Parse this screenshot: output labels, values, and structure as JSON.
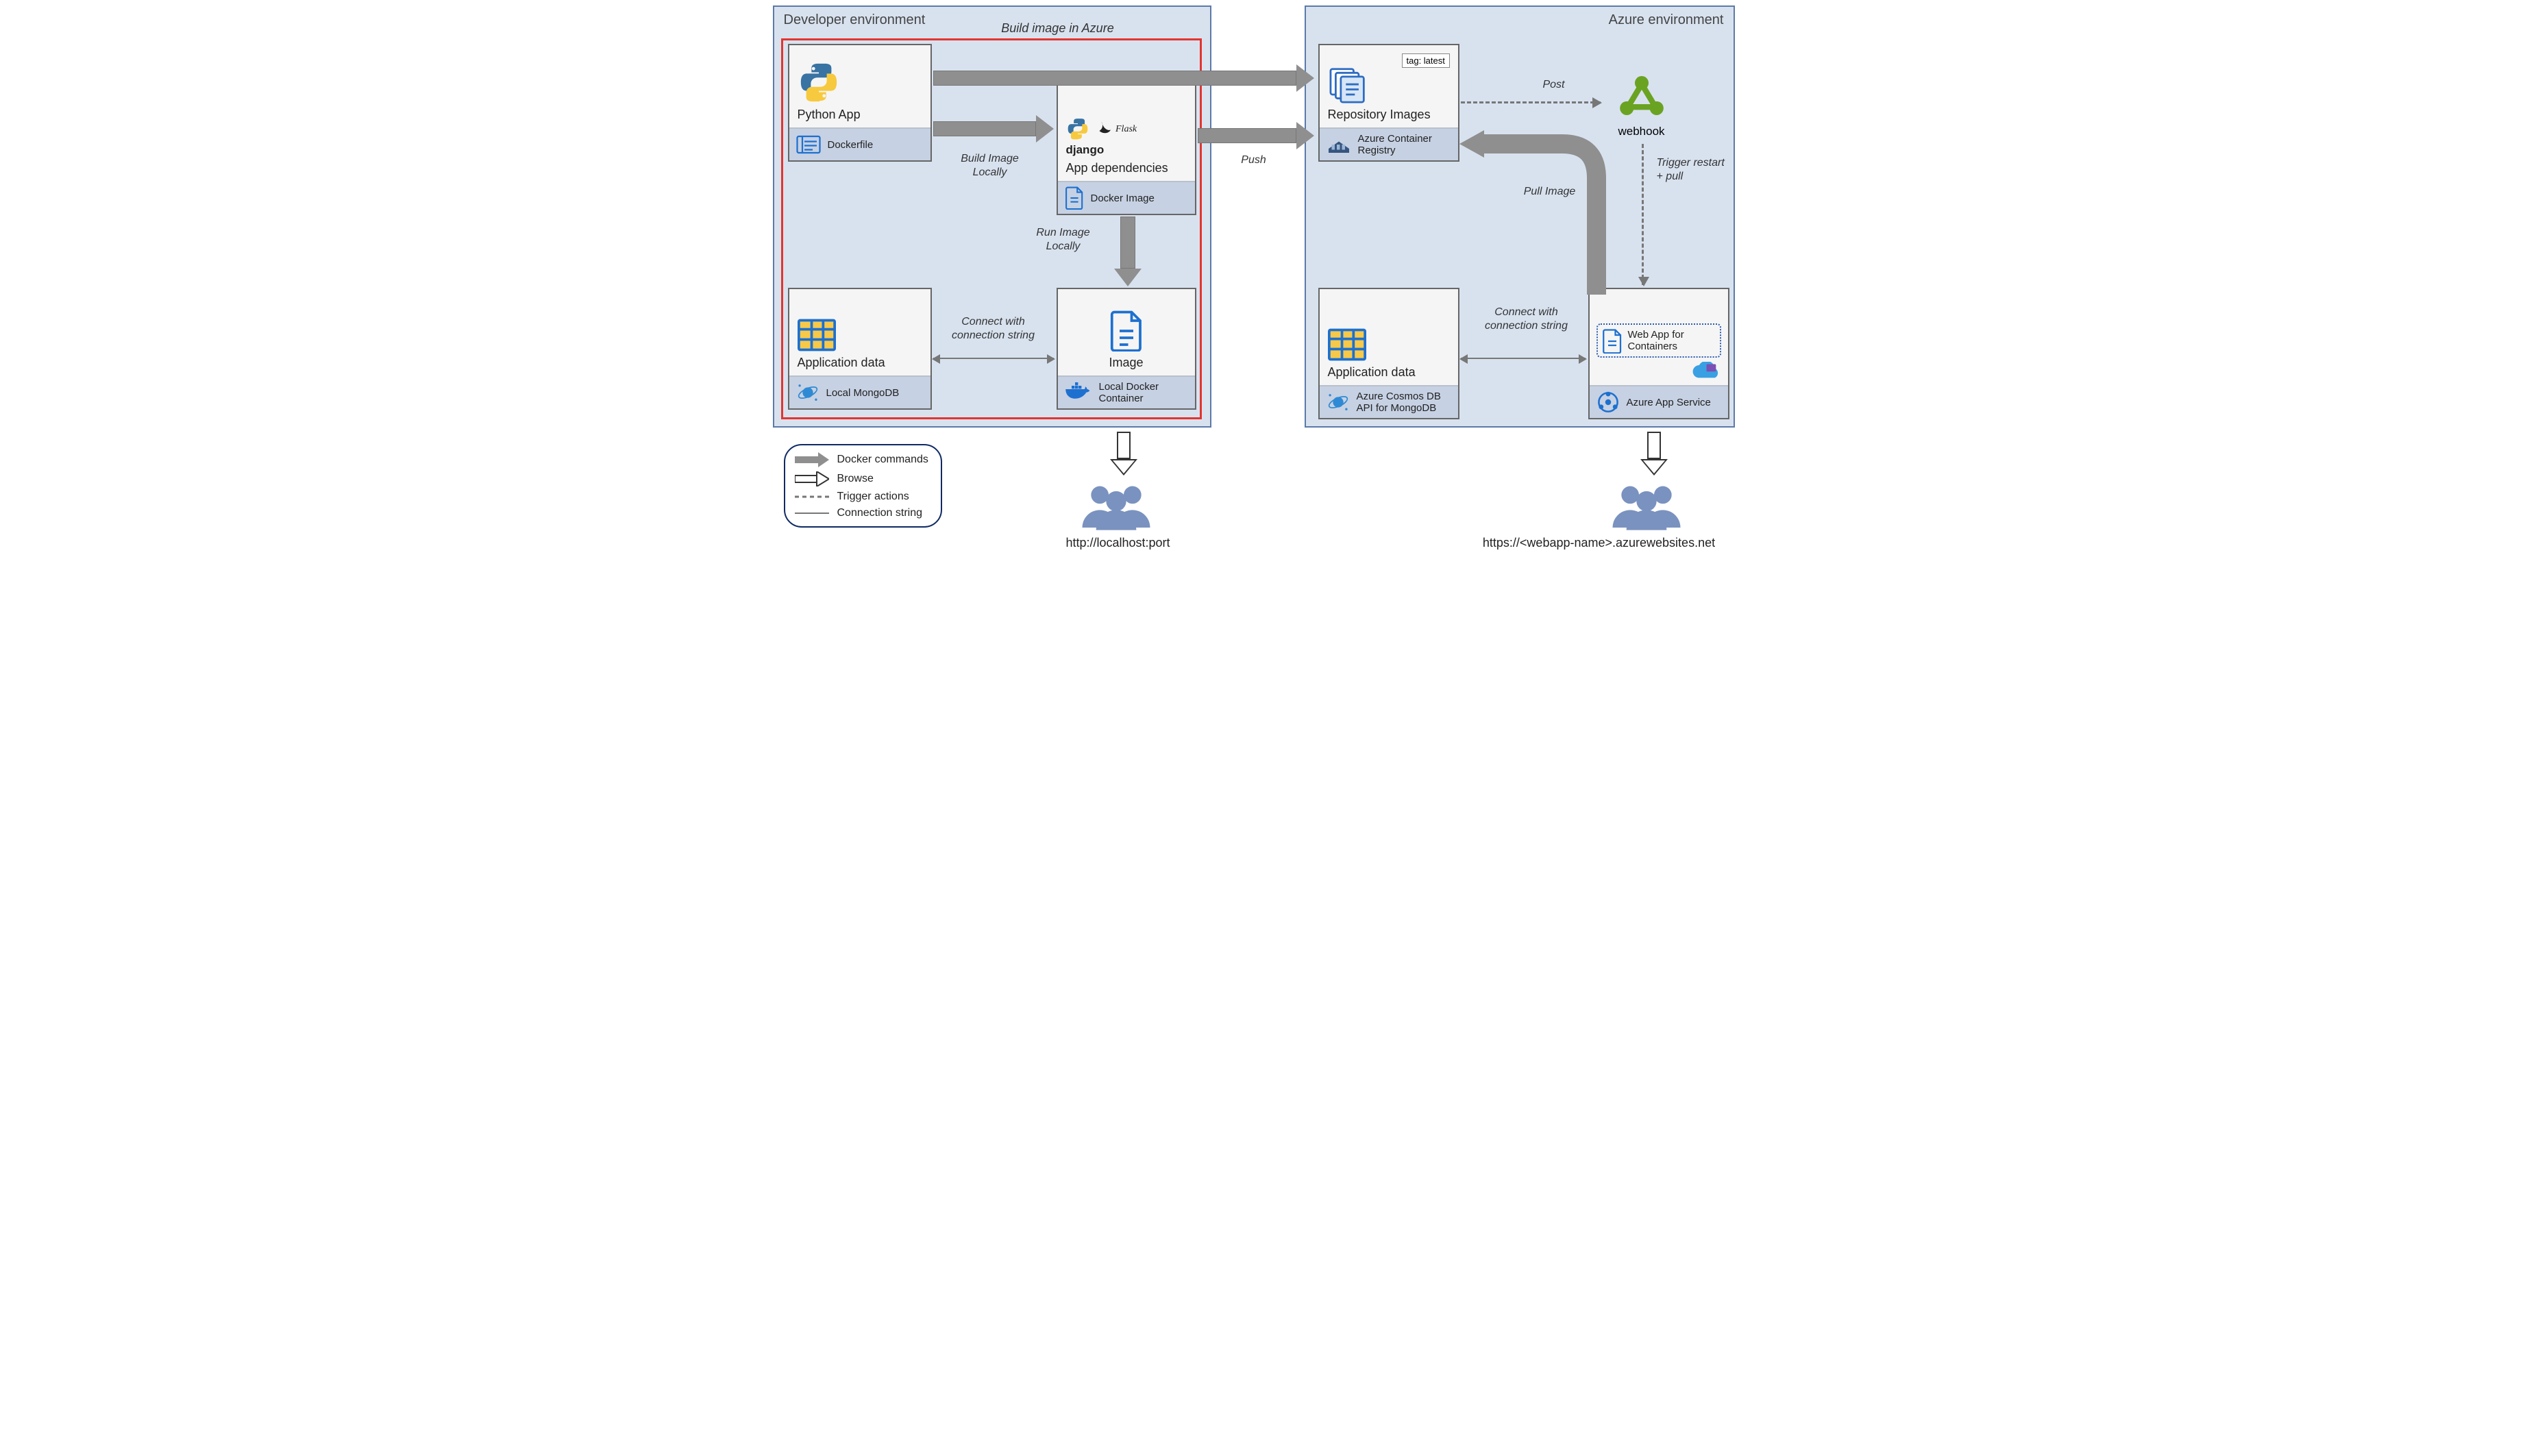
{
  "dev_env": {
    "title": "Developer environment"
  },
  "azure_env": {
    "title": "Azure environment"
  },
  "cards": {
    "python_app": {
      "title": "Python App",
      "footer": "Dockerfile"
    },
    "app_deps": {
      "title": "App dependencies",
      "footer": "Docker Image",
      "flask": "Flask",
      "django": "django"
    },
    "app_data_local": {
      "title": "Application data",
      "footer": "Local MongoDB"
    },
    "image_local": {
      "title": "Image",
      "footer": "Local Docker Container"
    },
    "repo_images": {
      "title": "Repository Images",
      "footer": "Azure Container Registry",
      "tag": "tag: latest"
    },
    "webhook": {
      "title": "webhook"
    },
    "app_data_azure": {
      "title": "Application data",
      "footer": "Azure Cosmos DB API for MongoDB"
    },
    "web_app": {
      "inner": "Web App for Containers",
      "footer": "Azure App Service"
    }
  },
  "arrows": {
    "build_azure": "Build image in Azure",
    "build_locally": "Build Image Locally",
    "run_locally": "Run Image Locally",
    "push": "Push",
    "connect_local": "Connect with connection string",
    "post": "Post",
    "trigger": "Trigger restart + pull",
    "pull_image": "Pull Image",
    "connect_azure": "Connect with connection string"
  },
  "urls": {
    "local": "http://localhost:port",
    "azure": "https://<webapp-name>.azurewebsites.net"
  },
  "legend": {
    "docker_cmds": "Docker commands",
    "browse": "Browse",
    "trigger": "Trigger actions",
    "conn": "Connection string"
  }
}
